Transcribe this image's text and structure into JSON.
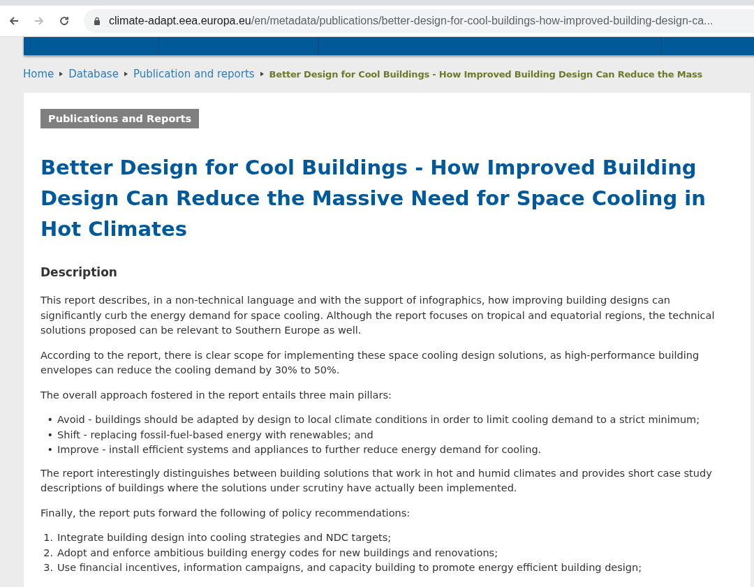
{
  "browser": {
    "url_host": "climate-adapt.eea.europa.eu",
    "url_path": "/en/metadata/publications/better-design-for-cool-buildings-how-improved-building-design-ca..."
  },
  "breadcrumb": [
    {
      "label": "Home",
      "current": false
    },
    {
      "label": "Database",
      "current": false
    },
    {
      "label": "Publication and reports",
      "current": false
    },
    {
      "label": "Better Design for Cool Buildings - How Improved Building Design Can Reduce the Mass",
      "current": true
    }
  ],
  "category_badge": "Publications and Reports",
  "title": "Better Design for Cool Buildings - How Improved Building Design Can Reduce the Massive Need for Space Cooling in Hot Climates",
  "section_heading": "Description",
  "content": [
    {
      "kind": "paragraph",
      "text": "This report describes, in a non-technical language and with the support of infographics, how improving building designs can significantly curb the energy demand for space cooling.  Although the report focuses on tropical and equatorial regions, the technical solutions proposed can be relevant to Southern Europe as well."
    },
    {
      "kind": "paragraph",
      "text": "According to the report, there is clear scope for implementing these space cooling design solutions, as high-performance building envelopes can reduce the cooling demand by 30% to 50%."
    },
    {
      "kind": "paragraph",
      "text": "The overall approach fostered in the report entails three main pillars:"
    },
    {
      "kind": "list",
      "items": [
        {
          "marker": "•",
          "text": "Avoid - buildings should be adapted by design to local climate conditions in order to limit cooling demand to a strict minimum;"
        },
        {
          "marker": "•",
          "text": "Shift - replacing fossil-fuel-based energy with renewables; and"
        },
        {
          "marker": "•",
          "text": "Improve - install efficient systems and appliances to further reduce energy demand for cooling."
        }
      ]
    },
    {
      "kind": "paragraph",
      "text": "The report interestingly distinguishes between building solutions that work in hot and humid climates and provides short case study descriptions of buildings where the solutions under scrutiny have actually been implemented."
    },
    {
      "kind": "paragraph",
      "text": "Finally, the report puts forward the following of policy recommendations:"
    },
    {
      "kind": "list",
      "items": [
        {
          "marker": "1.",
          "text": "Integrate building design into cooling strategies and NDC targets;"
        },
        {
          "marker": "2.",
          "text": "Adopt and enforce ambitious building energy codes for new buildings and renovations;"
        },
        {
          "marker": "3.",
          "text": "Use financial incentives, information campaigns, and capacity building to promote energy efficient building design;"
        }
      ]
    }
  ]
}
